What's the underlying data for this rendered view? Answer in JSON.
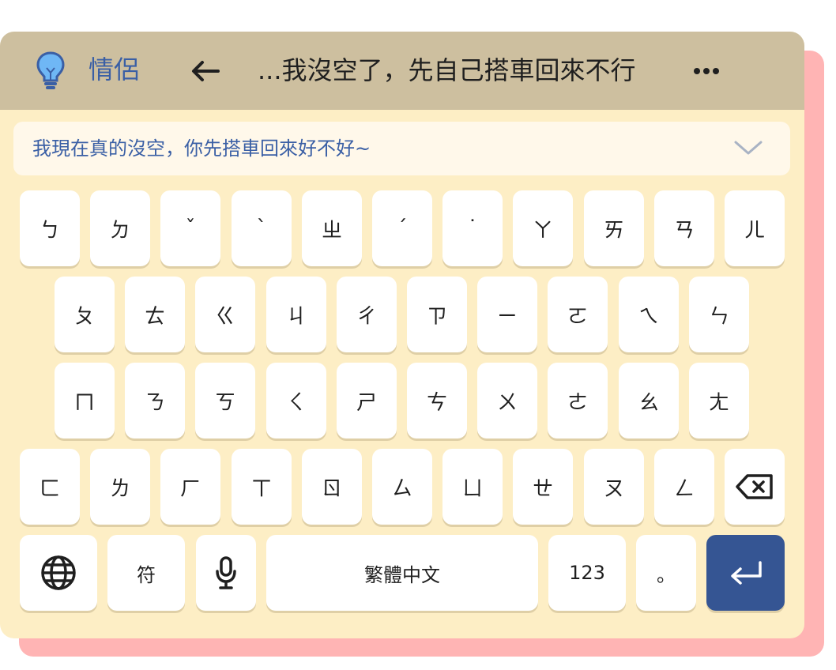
{
  "header": {
    "scene_label": "情侶",
    "draft_text": "...我沒空了，先自己搭車回來不行",
    "icons": {
      "scene": "lightbulb-icon",
      "back": "back-arrow-icon",
      "more": "more-icon"
    }
  },
  "suggestion": {
    "text": "我現在真的沒空，你先搭車回來好不好~",
    "icon": "chevron-down-icon"
  },
  "keyboard": {
    "row1": [
      "ㄅ",
      "ㄉ",
      "ˇ",
      "ˋ",
      "ㄓ",
      "ˊ",
      "˙",
      "ㄚ",
      "ㄞ",
      "ㄢ",
      "ㄦ"
    ],
    "row2": [
      "ㄆ",
      "ㄊ",
      "ㄍ",
      "ㄐ",
      "ㄔ",
      "ㄗ",
      "ㄧ",
      "ㄛ",
      "ㄟ",
      "ㄣ"
    ],
    "row3": [
      "ㄇ",
      "ㄋ",
      "ㄎ",
      "ㄑ",
      "ㄕ",
      "ㄘ",
      "ㄨ",
      "ㄜ",
      "ㄠ",
      "ㄤ"
    ],
    "row4": [
      "ㄈ",
      "ㄌ",
      "ㄏ",
      "ㄒ",
      "ㄖ",
      "ㄙ",
      "ㄩ",
      "ㄝ",
      "ㄡ",
      "ㄥ"
    ],
    "bottom": {
      "symbols_label": "符",
      "space_label": "繁體中文",
      "numbers_label": "123",
      "period_label": "。"
    },
    "icons": {
      "globe": "globe-icon",
      "mic": "mic-icon",
      "backspace": "backspace-icon",
      "enter": "enter-icon"
    }
  },
  "colors": {
    "accent": "#3a5fa5",
    "topbar": "#cdbf9f",
    "background": "#fdeec5",
    "shadow": "#ffb4b4",
    "enter_key": "#355593"
  }
}
